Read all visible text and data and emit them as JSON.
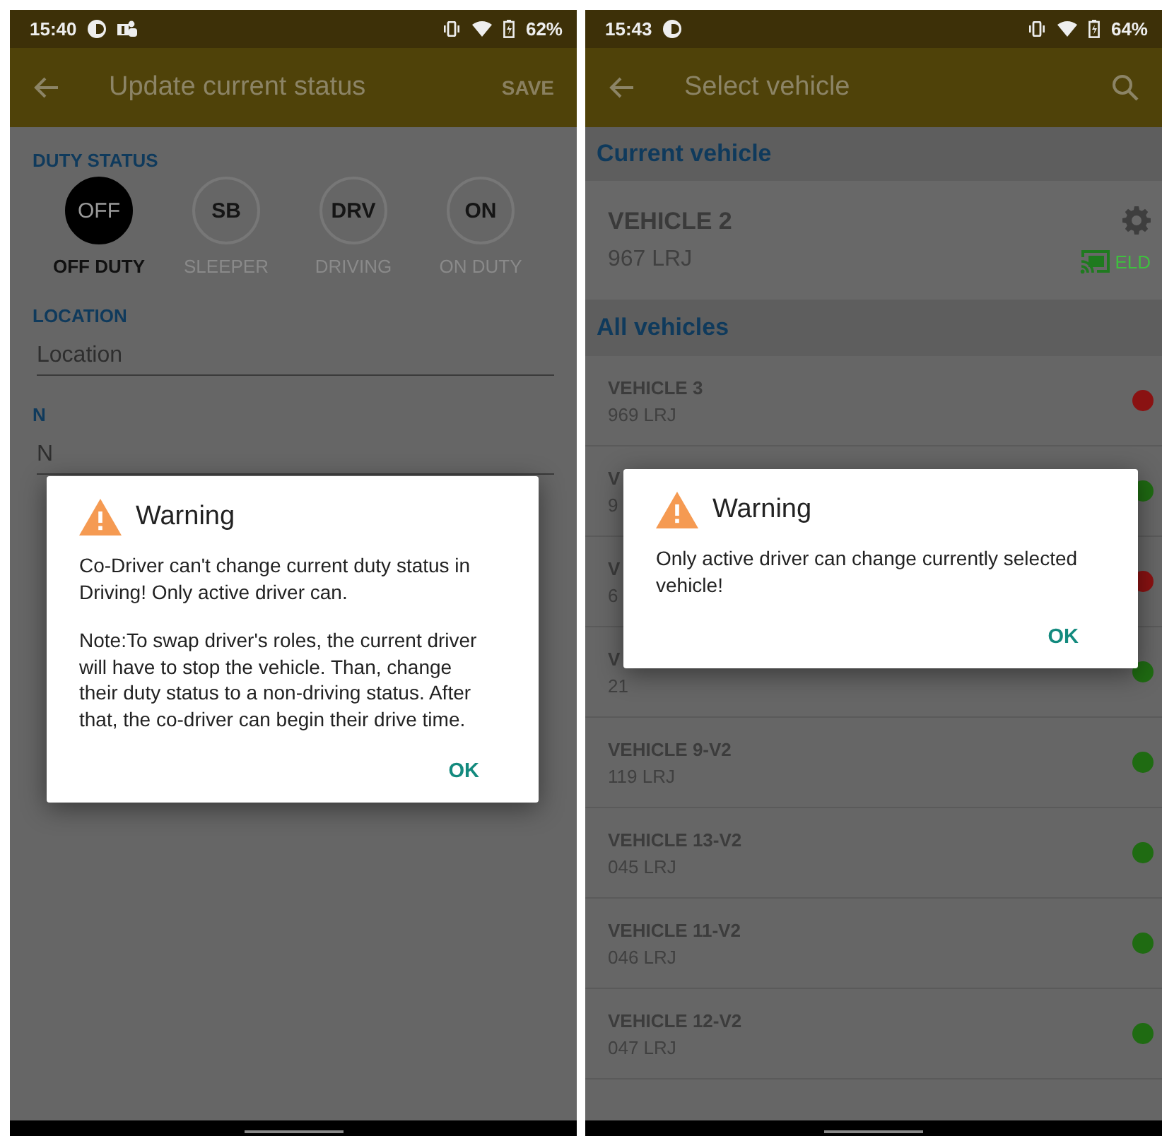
{
  "screens": [
    {
      "kind": "duty_status",
      "status_bar": {
        "time": "15:40",
        "battery": "62%",
        "notifications": [
          {
            "kind": "circle"
          },
          {
            "kind": "people"
          }
        ]
      },
      "app_bar": {
        "title": "Update current status",
        "action": "SAVE"
      },
      "duty_status": {
        "label": "DUTY STATUS",
        "options": [
          {
            "code": "OFF",
            "name": "OFF DUTY",
            "selected": true
          },
          {
            "code": "SB",
            "name": "SLEEPER",
            "selected": false
          },
          {
            "code": "DRV",
            "name": "DRIVING",
            "selected": false
          },
          {
            "code": "ON",
            "name": "ON DUTY",
            "selected": false
          }
        ]
      },
      "fields": [
        {
          "label": "LOCATION",
          "placeholder": "Location"
        },
        {
          "label": "N",
          "placeholder": "N"
        }
      ],
      "dialog": {
        "title": "Warning",
        "paragraphs": [
          "Co-Driver can't change current duty status in Driving! Only active driver can.",
          "Note:To swap driver's roles, the current driver will have to stop the vehicle. Than, change their duty status to a non-driving status. After that, the co-driver can begin their drive time."
        ],
        "button": "OK"
      }
    },
    {
      "kind": "vehicle_select",
      "status_bar": {
        "time": "15:43",
        "battery": "64%",
        "notifications": [
          {
            "kind": "circle"
          }
        ]
      },
      "app_bar": {
        "title": "Select vehicle"
      },
      "current_header": "Current vehicle",
      "current_vehicle": {
        "name": "VEHICLE 2",
        "plate": "967 LRJ",
        "badge": "ELD"
      },
      "all_header": "All vehicles",
      "vehicles": [
        {
          "name": "VEHICLE 3",
          "plate": "969 LRJ",
          "color": "#8a1212"
        },
        {
          "name": "V",
          "plate": "9",
          "color": "#1f6b12"
        },
        {
          "name": "V",
          "plate": "6",
          "color": "#8a1212"
        },
        {
          "name": "V",
          "plate": "21",
          "color": "#1f6b12"
        },
        {
          "name": "VEHICLE 9-V2",
          "plate": "119 LRJ",
          "color": "#1f6b12"
        },
        {
          "name": "VEHICLE 13-V2",
          "plate": "045 LRJ",
          "color": "#1f6b12"
        },
        {
          "name": "VEHICLE 11-V2",
          "plate": "046 LRJ",
          "color": "#1f6b12"
        },
        {
          "name": "VEHICLE 12-V2",
          "plate": "047 LRJ",
          "color": "#1f6b12"
        }
      ],
      "dialog": {
        "title": "Warning",
        "paragraphs": [
          "Only active driver can change currently selected vehicle!"
        ],
        "button": "OK"
      }
    }
  ]
}
